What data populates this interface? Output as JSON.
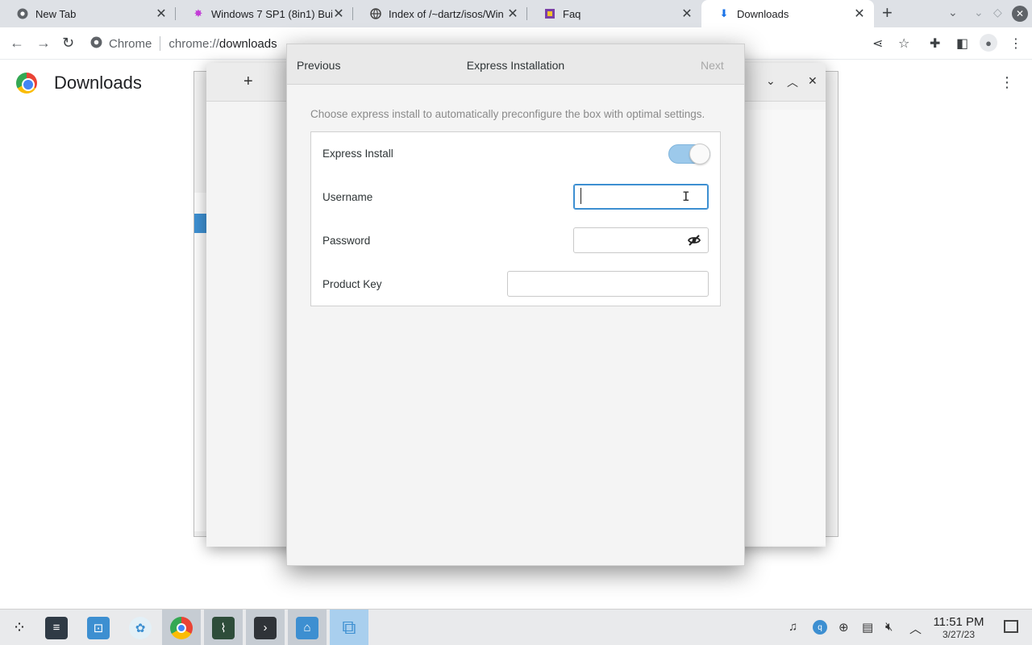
{
  "browser": {
    "tabs": [
      {
        "title": "New Tab",
        "icon": "chrome-icon"
      },
      {
        "title": "Windows 7 SP1 (8in1) Bui",
        "icon": "windows-star-icon"
      },
      {
        "title": "Index of /~dartz/isos/Win",
        "icon": "globe-icon"
      },
      {
        "title": "Faq",
        "icon": "faq-icon"
      },
      {
        "title": "Downloads",
        "icon": "download-icon"
      }
    ],
    "omnibox": {
      "site": "Chrome",
      "url_prefix": "chrome://",
      "url_path": "downloads"
    }
  },
  "page": {
    "title": "Downloads"
  },
  "dialog": {
    "previous_label": "Previous",
    "title": "Express Installation",
    "next_label": "Next",
    "description": "Choose express install to automatically preconfigure the box with optimal settings.",
    "fields": {
      "express_install": {
        "label": "Express Install",
        "value": "on"
      },
      "username": {
        "label": "Username",
        "value": ""
      },
      "password": {
        "label": "Password",
        "value": ""
      },
      "product_key": {
        "label": "Product Key",
        "value": ""
      }
    }
  },
  "taskbar": {
    "time": "11:51 PM",
    "date": "3/27/23"
  },
  "colors": {
    "accent": "#3d8fd1",
    "toggle_on": "#9cc9eb"
  }
}
